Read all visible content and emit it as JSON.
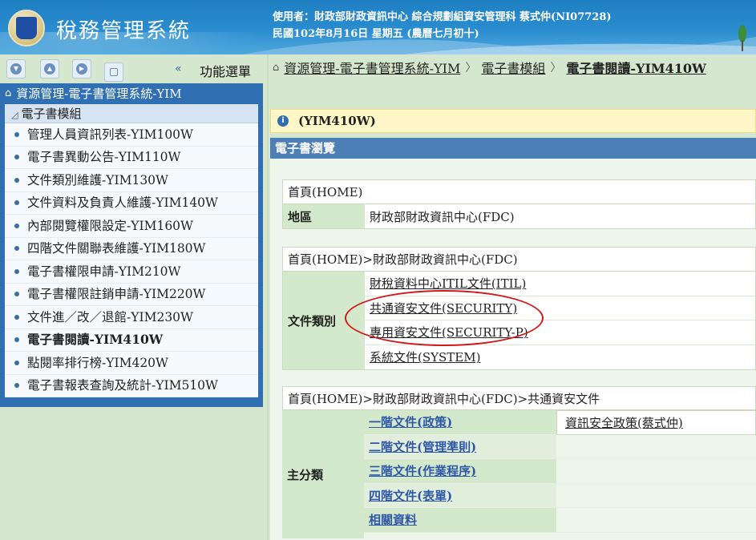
{
  "header": {
    "title": "稅務管理系統",
    "user_line": "使用者：財政部財政資訊中心 綜合規劃組資安管理科 蔡式仲(NI07728)",
    "date_line": "民國102年8月16日 星期五 (農曆七月初十)"
  },
  "menu": {
    "title": "功能選單",
    "root": "資源管理-電子書管理系統-YIM",
    "module": "電子書模組",
    "items": [
      {
        "label": "管理人員資訊列表-YIM100W"
      },
      {
        "label": "電子書異動公告-YIM110W"
      },
      {
        "label": "文件類別維護-YIM130W"
      },
      {
        "label": "文件資料及負責人維護-YIM140W"
      },
      {
        "label": "內部閱覽權限設定-YIM160W"
      },
      {
        "label": "四階文件關聯表維護-YIM180W"
      },
      {
        "label": "電子書權限申請-YIM210W"
      },
      {
        "label": "電子書權限註銷申請-YIM220W"
      },
      {
        "label": "文件進／改／退館-YIM230W"
      },
      {
        "label": "電子書閱讀-YIM410W"
      },
      {
        "label": "點閱率排行榜-YIM420W"
      },
      {
        "label": "電子書報表查詢及統計-YIM510W"
      }
    ]
  },
  "breadcrumb": {
    "b1": "資源管理-電子書管理系統-YIM",
    "b2": "電子書模組",
    "b3": "電子書閱讀-YIM410W"
  },
  "page": {
    "code": "(YIM410W)",
    "section": "電子書瀏覽"
  },
  "table1": {
    "caption": "首頁(HOME)",
    "label": "地區",
    "value": "財政部財政資訊中心(FDC)"
  },
  "table2": {
    "caption": "首頁(HOME)>財政部財政資訊中心(FDC)",
    "label": "文件類別",
    "items": [
      "財稅資料中心ITIL文件(ITIL)",
      "共通資安文件(SECURITY)",
      "專用資安文件(SECURITY-P)",
      "系統文件(SYSTEM)"
    ]
  },
  "table3": {
    "caption": "首頁(HOME)>財政部財政資訊中心(FDC)>共通資安文件",
    "label": "主分類",
    "items": [
      "一階文件(政策)",
      "二階文件(管理準則)",
      "三階文件(作業程序)",
      "四階文件(表單)",
      "相關資料"
    ],
    "doc": "資訊安全政策(蔡式仲)"
  },
  "colors": {
    "header_blue": "#2a8dd0",
    "menu_blue": "#2f6fb2",
    "info_yellow": "#fff7c8",
    "highlight_red": "#d01818"
  }
}
